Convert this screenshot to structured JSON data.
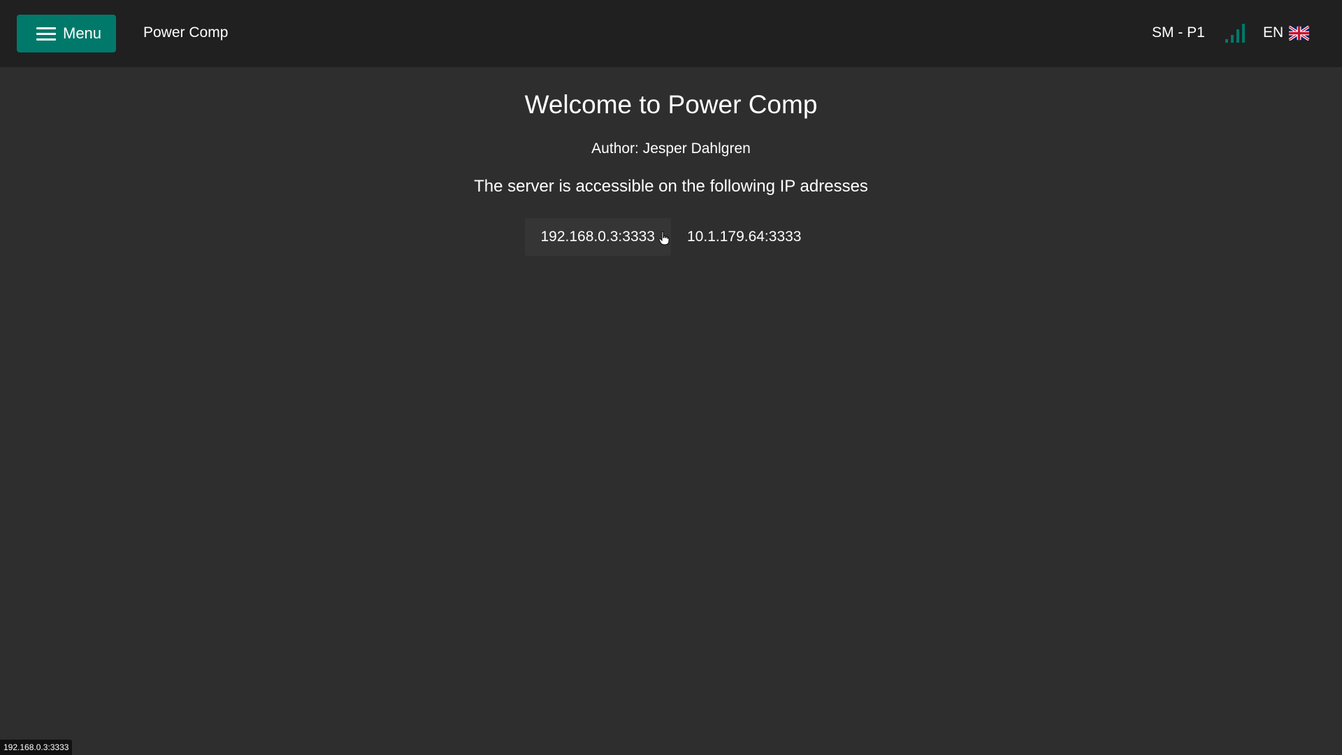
{
  "header": {
    "menu_label": "Menu",
    "app_title": "Power Comp",
    "device_label": "SM - P1",
    "language_label": "EN",
    "accent_color": "#00796b",
    "icons": {
      "menu": "hamburger-icon",
      "signal": "signal-strength-icon",
      "language": "uk-flag-icon"
    }
  },
  "main": {
    "heading": "Welcome to Power Comp",
    "author": "Author: Jesper Dahlgren",
    "server_info": "The server is accessible on the following IP adresses",
    "ip_addresses": [
      {
        "label": "192.168.0.3:3333"
      },
      {
        "label": "10.1.179.64:3333"
      }
    ]
  },
  "status_bar": {
    "url": "192.168.0.3:3333"
  }
}
